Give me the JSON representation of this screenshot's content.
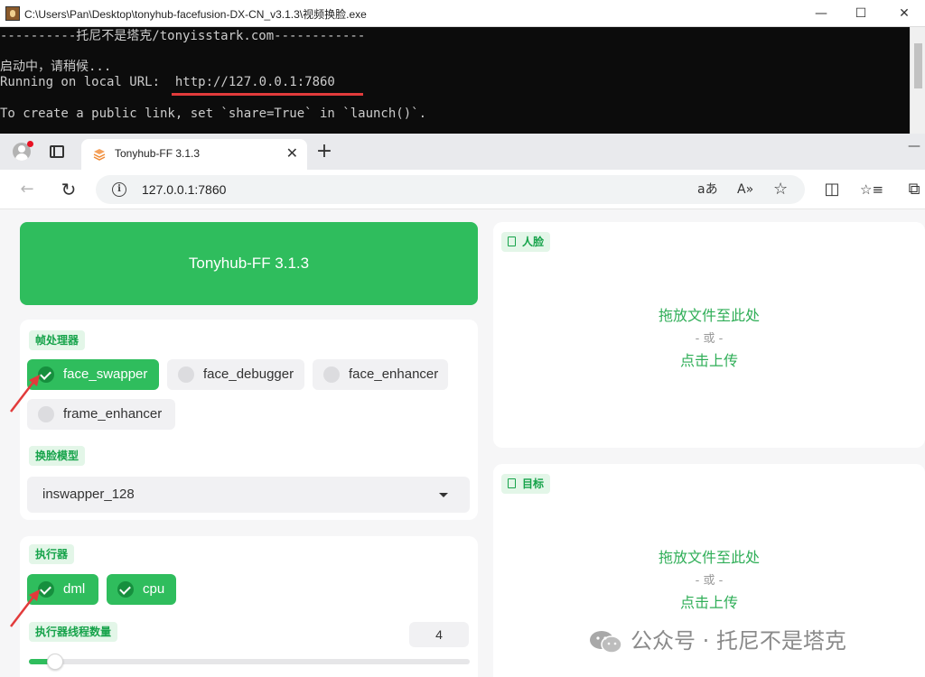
{
  "console": {
    "title": "C:\\Users\\Pan\\Desktop\\tonyhub-facefusion-DX-CN_v3.1.3\\视频换脸.exe",
    "lines": [
      "----------托尼不是塔克/tonyisstark.com------------",
      "",
      "启动中，请稍候...",
      "Running on local URL:  http://127.0.0.1:7860",
      "",
      "To create a public link, set `share=True` in `launch()`."
    ],
    "min_glyph": "—",
    "max_glyph": "☐",
    "close_glyph": "✕"
  },
  "browser": {
    "tab_title": "Tonyhub-FF 3.1.3",
    "tab_close": "✕",
    "new_tab": "+",
    "url": "127.0.0.1:7860",
    "toolbar_icons": [
      "back-arrow-icon",
      "refresh-icon",
      "info-icon",
      "read-aloud-icon",
      "text-size-icon",
      "favorite-star-icon",
      "split-screen-icon",
      "favorites-icon",
      "collections-icon"
    ],
    "glyphs": {
      "back": "←",
      "refresh": "↻",
      "info": "i",
      "translate": "aあ",
      "read_aloud": "A»",
      "star": "☆",
      "split": "◫",
      "favorites": "☆≡",
      "collections": "⧉",
      "minimize": "—"
    }
  },
  "app": {
    "header_title": "Tonyhub-FF 3.1.3",
    "frame_processors": {
      "label": "帧处理器",
      "options": [
        {
          "label": "face_swapper",
          "checked": true
        },
        {
          "label": "face_debugger",
          "checked": false
        },
        {
          "label": "face_enhancer",
          "checked": false
        },
        {
          "label": "frame_enhancer",
          "checked": false
        }
      ]
    },
    "face_swapper_model": {
      "label": "换脸模型",
      "value": "inswapper_128"
    },
    "execution_providers": {
      "label": "执行器",
      "options": [
        {
          "label": "dml",
          "checked": true
        },
        {
          "label": "cpu",
          "checked": true
        }
      ]
    },
    "thread_count": {
      "label": "执行器线程数量",
      "value": "4",
      "slider_fraction": 0.04
    },
    "source_panel": {
      "label": "人脸",
      "drop_text": "拖放文件至此处",
      "or_text": "- 或 -",
      "click_text": "点击上传"
    },
    "target_panel": {
      "label": "目标",
      "drop_text": "拖放文件至此处",
      "or_text": "- 或 -",
      "click_text": "点击上传"
    },
    "accent_color": "#2fbd5d"
  },
  "watermark": {
    "text": "公众号 · 托尼不是塔克"
  }
}
